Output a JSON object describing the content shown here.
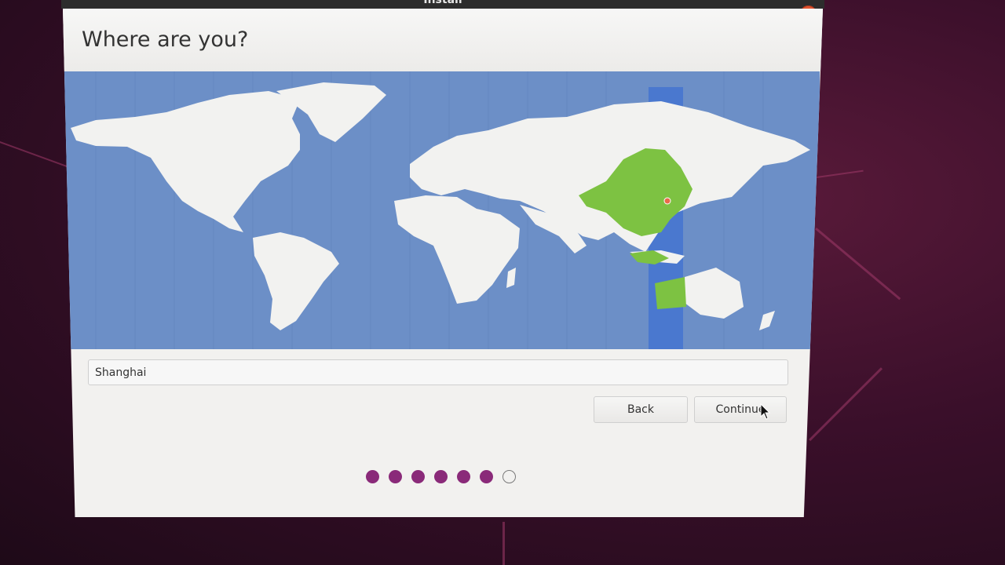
{
  "window": {
    "title": "Install",
    "close_icon": "close-icon"
  },
  "page": {
    "title": "Where are you?"
  },
  "map": {
    "selected_region": "Shanghai",
    "highlight_color": "#7dc242",
    "ocean_color": "#6c8fc7",
    "land_color": "#f2f2f0"
  },
  "location": {
    "value": "Shanghai"
  },
  "buttons": {
    "back": "Back",
    "continue": "Continue"
  },
  "progress": {
    "steps_total": 7,
    "steps_completed": 6,
    "accent": "#8a2a79"
  }
}
